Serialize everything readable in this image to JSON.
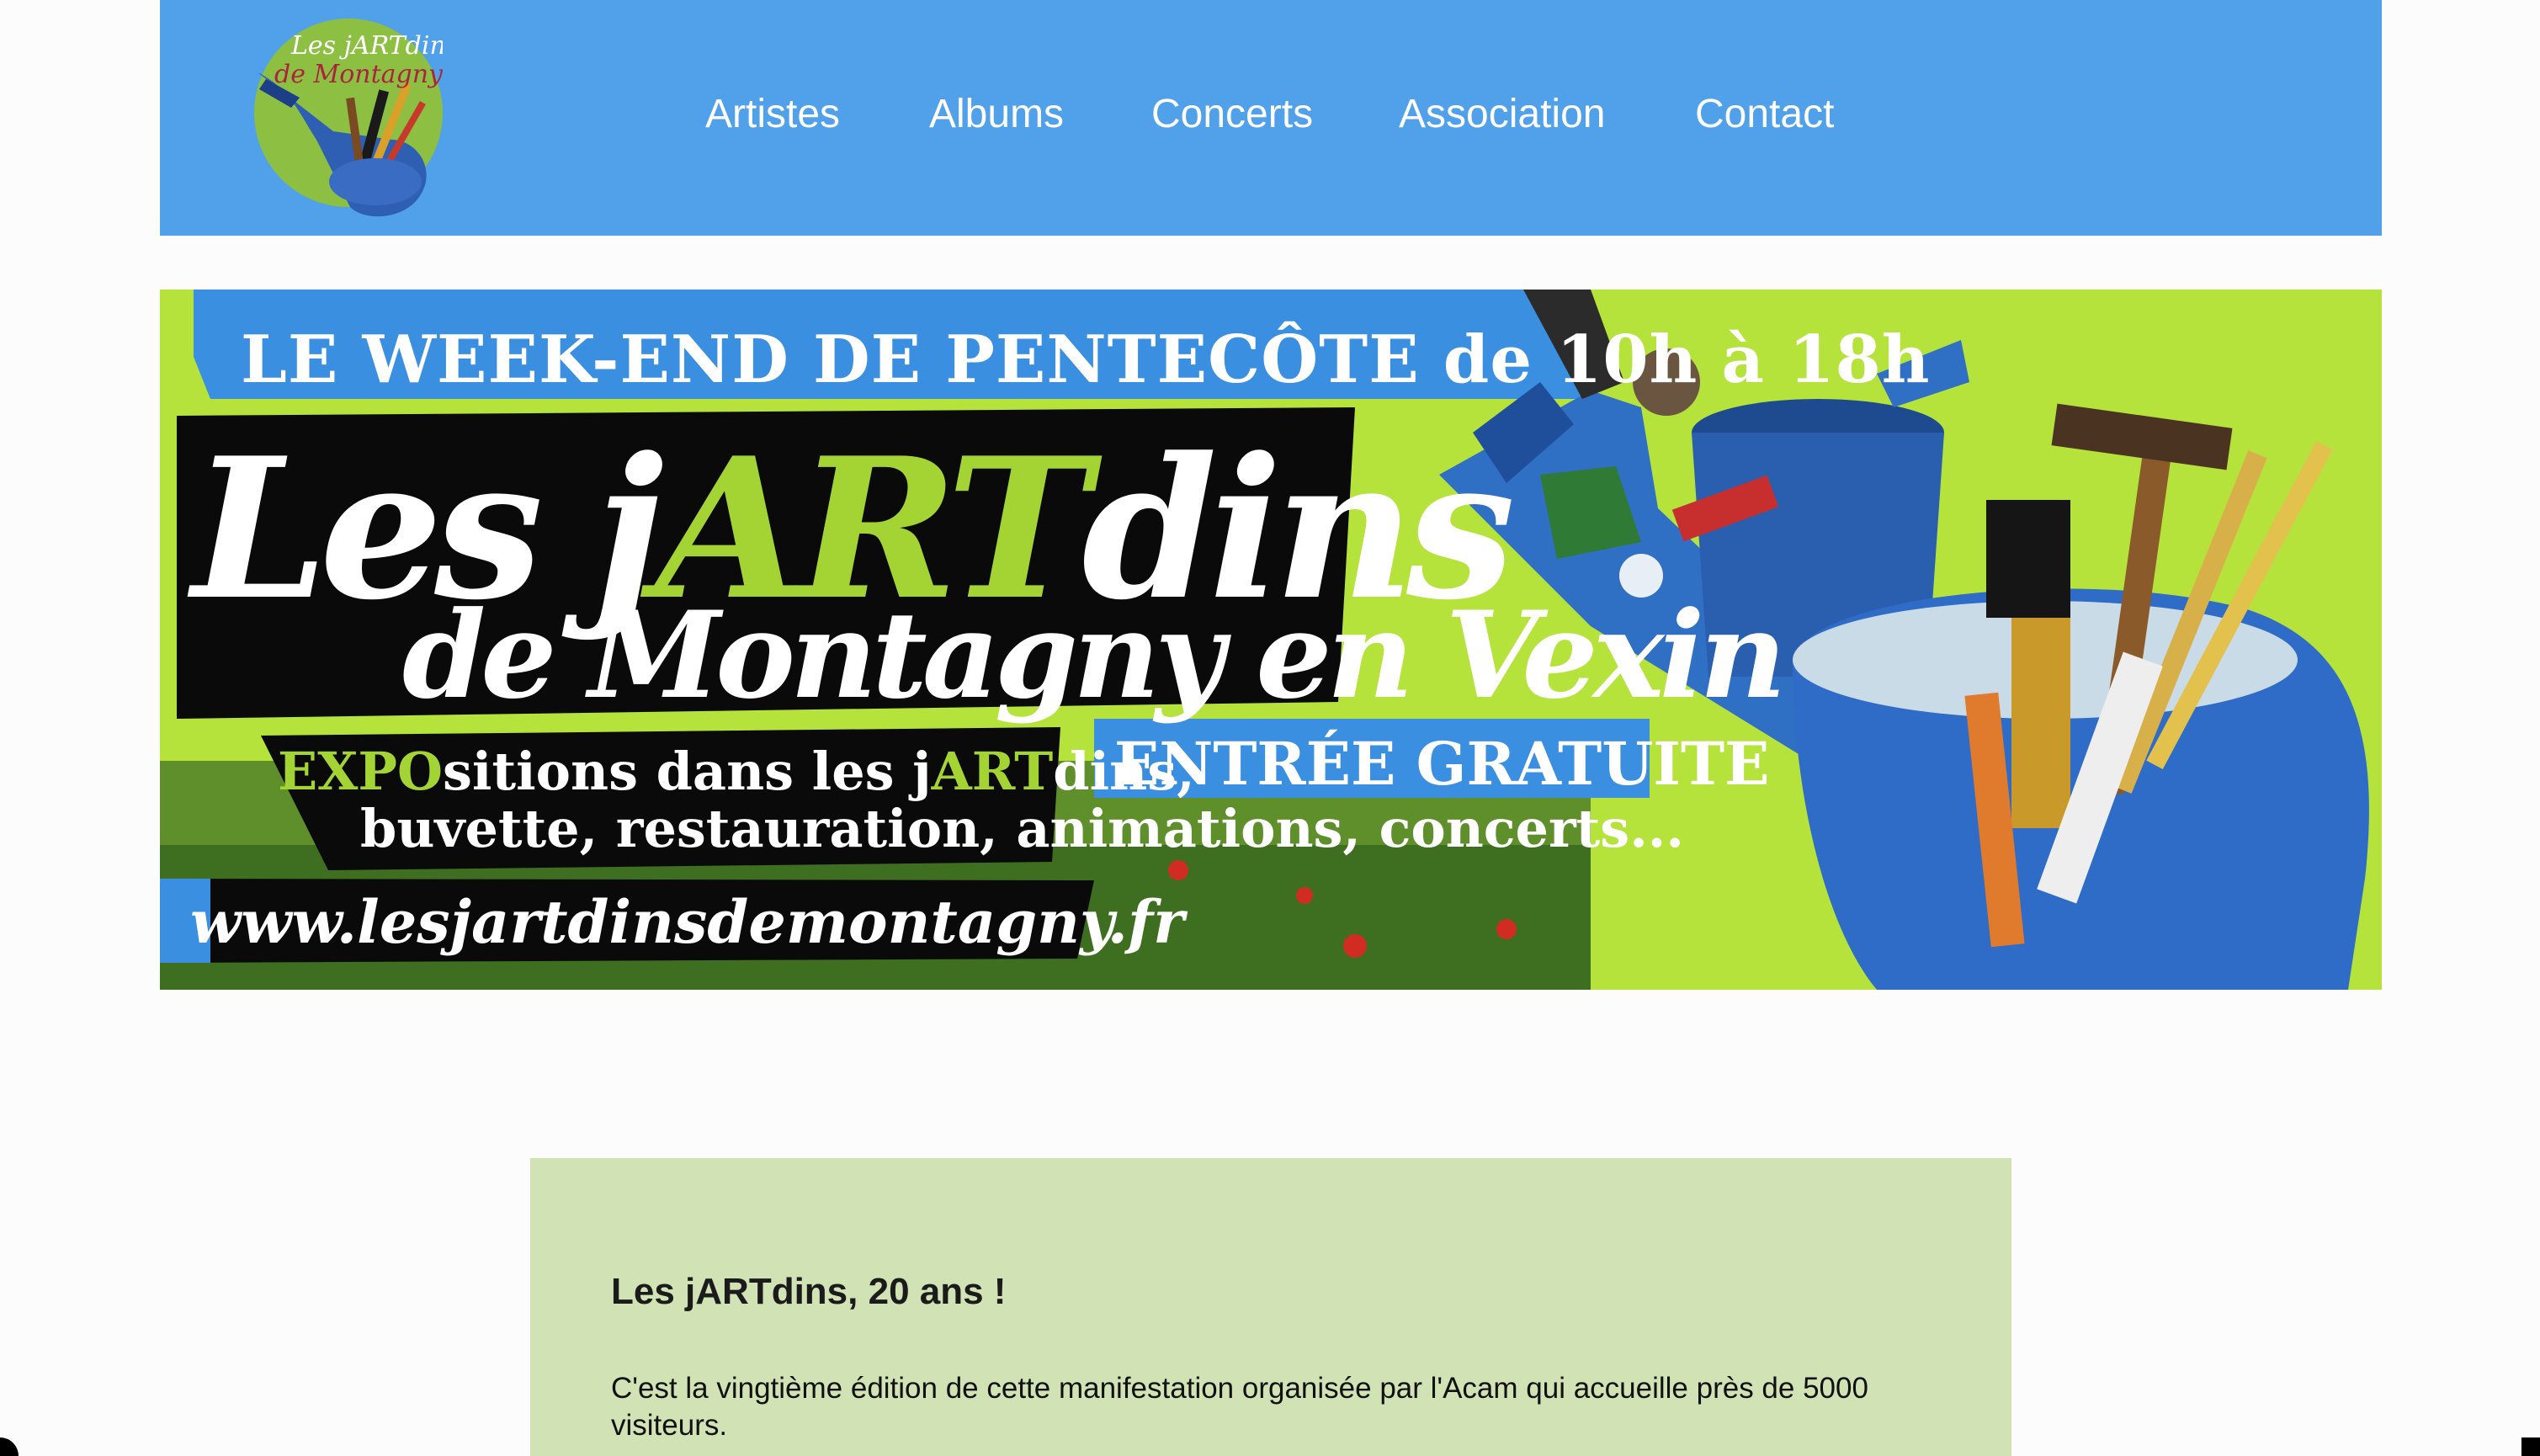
{
  "header": {
    "logo_text_1": "Les jARTdins",
    "logo_text_2": "de Montagny",
    "nav": [
      {
        "label": "Artistes"
      },
      {
        "label": "Albums"
      },
      {
        "label": "Concerts"
      },
      {
        "label": "Association"
      },
      {
        "label": "Contact"
      }
    ],
    "background_color": "#50a0ea"
  },
  "banner": {
    "top_line": "LE WEEK-END DE PENTECÔTE de 10h à 18h",
    "title_part1": "Les j",
    "title_highlight": "ART",
    "title_part2": "dins",
    "subtitle": "de Montagny en Vexin",
    "badge": "ENTRÉE GRATUITE",
    "line1_highlight": "EXPO",
    "line1_rest": "sitions dans les j",
    "line1_highlight2": "ART",
    "line1_end": "dins,",
    "line2": "buvette, restauration, animations, concerts...",
    "url": "www.lesjartdinsdemontagny.fr",
    "accent_color": "#a4d433"
  },
  "article": {
    "title": "Les jARTdins, 20 ans !",
    "body": "C'est la vingtième édition de cette manifestation organisée par l'Acam qui accueille près de 5000 visiteurs.",
    "background_color": "#d1e3b4"
  }
}
